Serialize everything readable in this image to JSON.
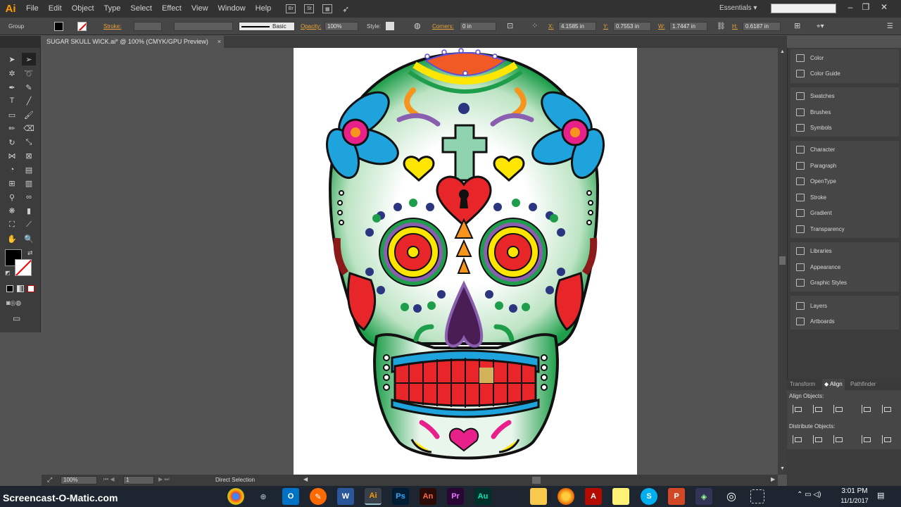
{
  "app": {
    "logo": "Ai",
    "menus": [
      "File",
      "Edit",
      "Object",
      "Type",
      "Select",
      "Effect",
      "View",
      "Window",
      "Help"
    ],
    "bridge_label": "Br",
    "stock_label": "St",
    "workspace": "Essentials",
    "search_placeholder": ""
  },
  "control_bar": {
    "selection_type": "Group",
    "stroke_label": "Stroke:",
    "brush_profile": "Basic",
    "opacity_label": "Opacity:",
    "opacity_value": "100%",
    "style_label": "Style:",
    "corners_label": "Corners:",
    "corners_value": "0 in",
    "x_label": "X:",
    "x_value": "4.1585 in",
    "y_label": "Y:",
    "y_value": "0.7553 in",
    "w_label": "W:",
    "w_value": "1.7447 in",
    "h_label": "H:",
    "h_value": "0.6187 in"
  },
  "document": {
    "tab_title": "SUGAR SKULL WICK.ai* @ 100% (CMYK/GPU Preview)",
    "close_glyph": "×"
  },
  "status_bar": {
    "zoom": "100%",
    "artboard_number": "1",
    "tool_status": "Direct Selection"
  },
  "panels": {
    "group1": [
      "Color",
      "Color Guide"
    ],
    "group2": [
      "Swatches",
      "Brushes",
      "Symbols"
    ],
    "group3": [
      "Character",
      "Paragraph",
      "OpenType",
      "Stroke",
      "Gradient",
      "Transparency"
    ],
    "group4": [
      "Libraries",
      "Appearance",
      "Graphic Styles"
    ],
    "group5": [
      "Layers",
      "Artboards"
    ]
  },
  "align_panel": {
    "tabs": [
      "Transform",
      "Align",
      "Pathfinder"
    ],
    "active_tab": "Align",
    "align_objects": "Align Objects:",
    "distribute_objects": "Distribute Objects:"
  },
  "taskbar": {
    "watermark": "Screencast-O-Matic.com",
    "apps": [
      "Chrome",
      "Edge-ish",
      "Outlook",
      "Pencil",
      "Word",
      "Illustrator",
      "Photoshop",
      "Animate",
      "Premiere",
      "Audition",
      "Explorer",
      "Firefox",
      "Acrobat",
      "Notes",
      "Skype",
      "PowerPoint",
      "Other",
      "Clock",
      "Capture"
    ],
    "app_labels": [
      "",
      "",
      "O",
      "",
      "W",
      "Ai",
      "Ps",
      "An",
      "Pr",
      "Au",
      "",
      "",
      "",
      "",
      "S",
      "P",
      "",
      "",
      ""
    ],
    "time": "3:01 PM",
    "date": "11/1/2017"
  },
  "colors": {
    "illustrator_orange": "#ff9a00",
    "chrome_bg": "#323232",
    "canvas_bg": "#535353",
    "skull_green": "#1e9e4a",
    "skull_red": "#e8262a",
    "skull_yellow": "#ffe600",
    "skull_blue": "#1fa3dc",
    "skull_purple": "#4b1d55"
  }
}
